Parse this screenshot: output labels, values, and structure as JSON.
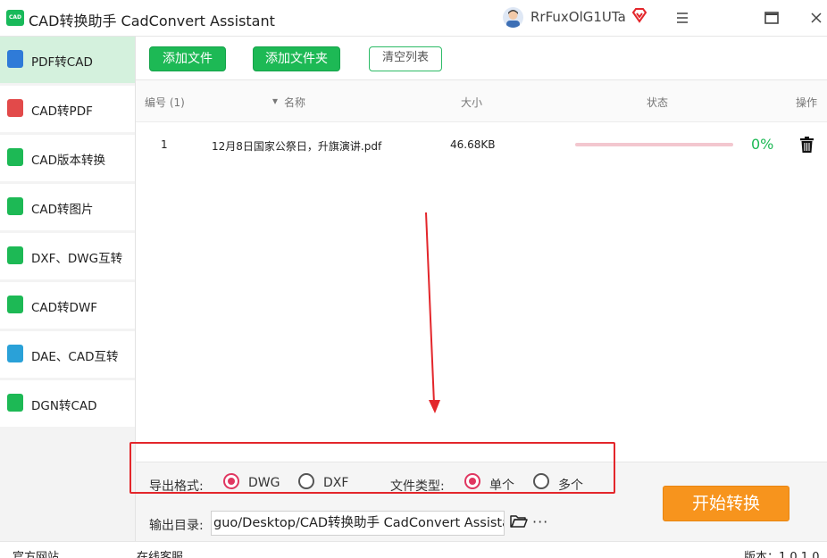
{
  "window": {
    "app_logo_text": "CAD",
    "title": "CAD转换助手 CadConvert Assistant",
    "username": "RrFuxOlG1UTa",
    "icons": {
      "avatar": "user-avatar",
      "vip": "vip-diamond-icon",
      "menu": "hamburger-menu-icon",
      "maximize": "maximize-icon",
      "close": "close-icon"
    }
  },
  "sidebar": {
    "items": [
      {
        "label": "PDF转CAD",
        "active": true,
        "color": "#2f7bd8"
      },
      {
        "label": "CAD转PDF",
        "active": false,
        "color": "#e24a4a"
      },
      {
        "label": "CAD版本转换",
        "active": false,
        "color": "#1db955"
      },
      {
        "label": "CAD转图片",
        "active": false,
        "color": "#1db955"
      },
      {
        "label": "DXF、DWG互转",
        "active": false,
        "color": "#1db955"
      },
      {
        "label": "CAD转DWF",
        "active": false,
        "color": "#1db955"
      },
      {
        "label": "DAE、CAD互转",
        "active": false,
        "color": "#2aa1d8"
      },
      {
        "label": "DGN转CAD",
        "active": false,
        "color": "#1db955"
      }
    ]
  },
  "toolbar": {
    "add_file": "添加文件",
    "add_folder": "添加文件夹",
    "clear_list": "清空列表"
  },
  "table": {
    "headers": {
      "index": "编号 (1)",
      "name": "名称",
      "size": "大小",
      "status": "状态",
      "action": "操作"
    },
    "rows": [
      {
        "index": "1",
        "name": "12月8日国家公祭日，升旗演讲.pdf",
        "size": "46.68KB",
        "progress": 0,
        "percent": "0%"
      }
    ]
  },
  "options": {
    "format_label": "导出格式:",
    "format_options": [
      "DWG",
      "DXF"
    ],
    "format_selected": "DWG",
    "type_label": "文件类型:",
    "type_options": [
      "单个",
      "多个"
    ],
    "type_selected": "单个",
    "output_label": "输出目录:",
    "output_path": "guo/Desktop/CAD转换助手 CadConvert Assistant",
    "more": "···"
  },
  "start_button": "开始转换",
  "footer": {
    "website": "官方网站",
    "support": "在线客服",
    "version": "版本：1.0.1.0"
  },
  "colors": {
    "accent": "#1db955",
    "start": "#f7941d",
    "annotation": "#e3262b",
    "radio": "#e03660"
  }
}
